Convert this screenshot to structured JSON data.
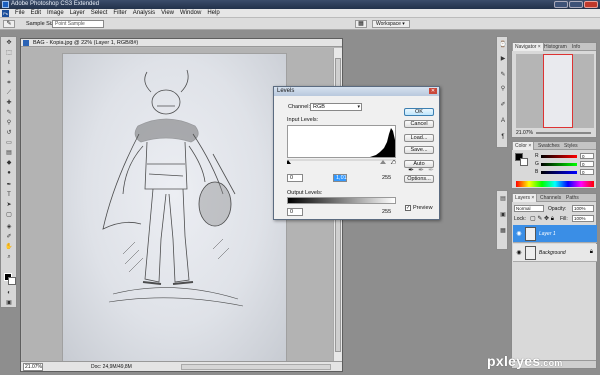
{
  "titlebar": {
    "title": "Adobe Photoshop CS3 Extended"
  },
  "menubar": {
    "logo": "Ps",
    "items": [
      "File",
      "Edit",
      "Image",
      "Layer",
      "Select",
      "Filter",
      "Analysis",
      "View",
      "Window",
      "Help"
    ]
  },
  "optionsbar": {
    "tool_icon": "eyedropper-icon",
    "sample_label": "Sample Size:",
    "sample_value": "Point Sample",
    "workspace_label": "Workspace ▾"
  },
  "document": {
    "title": "BAG - Kopia.jpg @ 22% (Layer 1, RGB/8#)",
    "zoom": "21.07%",
    "doc_info": "Doc: 24,9M/49,8M"
  },
  "levels": {
    "title": "Levels",
    "channel_label": "Channel:",
    "channel_value": "RGB",
    "input_label": "Input Levels:",
    "input_black": "0",
    "input_gray": "1,01",
    "input_white": "255",
    "output_label": "Output Levels:",
    "output_black": "0",
    "output_white": "255",
    "buttons": {
      "ok": "OK",
      "cancel": "Cancel",
      "load": "Load...",
      "save": "Save...",
      "auto": "Auto",
      "options": "Options..."
    },
    "preview_label": "Preview",
    "preview_checked": true
  },
  "panels": {
    "nav_tabs": [
      "Navigator ×",
      "Histogram",
      "Info"
    ],
    "nav_zoom": "21.07%",
    "color_tabs": [
      "Color ×",
      "Swatches",
      "Styles"
    ],
    "color": {
      "r": "R",
      "g": "G",
      "b": "B",
      "rv": "0",
      "gv": "0",
      "bv": "0"
    },
    "layer_tabs": [
      "Layers ×",
      "Channels",
      "Paths"
    ],
    "blend_mode": "Normal",
    "opacity_label": "Opacity:",
    "opacity": "100%",
    "lock_label": "Lock:",
    "fill_label": "Fill:",
    "fill": "100%",
    "layers": [
      {
        "name": "Layer 1",
        "active": true
      },
      {
        "name": "Background",
        "active": false
      }
    ]
  },
  "watermark": {
    "text": "pxleyes",
    "suffix": ".com"
  },
  "colors": {
    "accent": "#3a8ee6",
    "highlight": "#3399ff"
  }
}
